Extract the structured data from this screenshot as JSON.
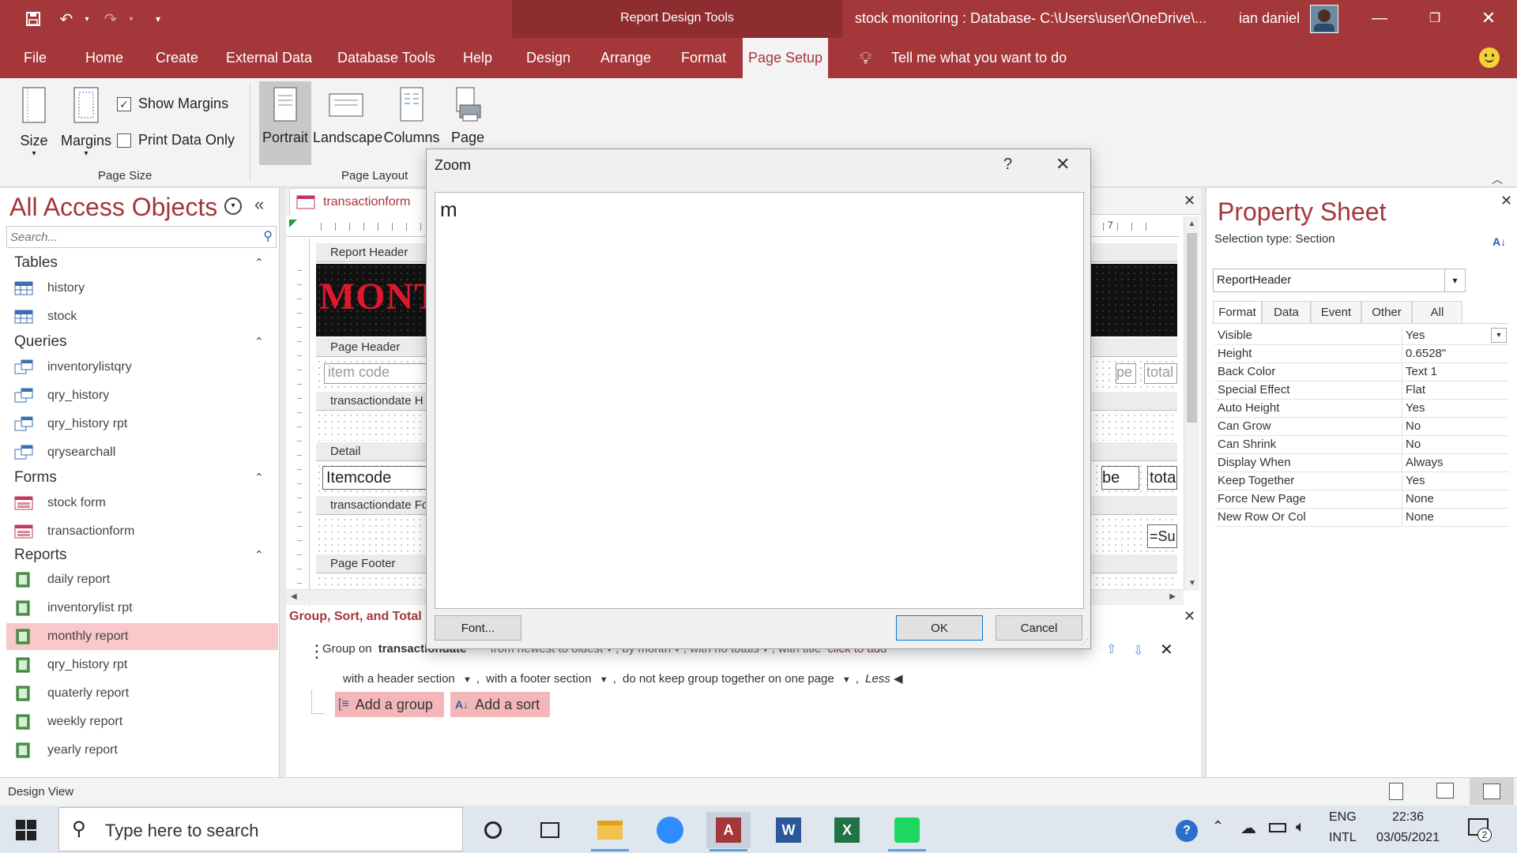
{
  "window": {
    "context_title": "Report Design Tools",
    "title": "stock monitoring : Database- C:\\Users\\user\\OneDrive\\...",
    "user": "ian daniel",
    "colors": {
      "accent": "#a4373a",
      "ribbon": "#f3f3f3",
      "selected": "#f8c8ca"
    }
  },
  "tabs": [
    "File",
    "Home",
    "Create",
    "External Data",
    "Database Tools",
    "Help",
    "Design",
    "Arrange",
    "Format",
    "Page Setup"
  ],
  "active_tab": "Page Setup",
  "tell_me": "Tell me what you want to do",
  "ribbon": {
    "size": "Size",
    "margins": "Margins",
    "show_margins": "Show Margins",
    "print_data_only": "Print Data Only",
    "page_size_group": "Page Size",
    "portrait": "Portrait",
    "landscape": "Landscape",
    "columns": "Columns",
    "page": "Page",
    "page_layout_group": "Page Layout",
    "show_margins_checked": true,
    "print_data_only_checked": false
  },
  "nav": {
    "title": "All Access Objects",
    "search_placeholder": "Search...",
    "categories": [
      {
        "name": "Tables",
        "items": [
          "history",
          "stock"
        ]
      },
      {
        "name": "Queries",
        "items": [
          "inventorylistqry",
          "qry_history",
          "qry_history rpt",
          "qrysearchall"
        ]
      },
      {
        "name": "Forms",
        "items": [
          "stock form",
          "transactionform"
        ]
      },
      {
        "name": "Reports",
        "items": [
          "daily report",
          "inventorylist rpt",
          "monthly report",
          "qry_history rpt",
          "quaterly report",
          "weekly report",
          "yearly report"
        ]
      }
    ],
    "selected_item": "monthly report"
  },
  "document": {
    "tab_label": "transactionform",
    "sections": [
      "Report Header",
      "Page Header",
      "transactiondate H",
      "Detail",
      "transactiondate Fo",
      "Page Footer"
    ],
    "header_text": "MONTI",
    "field_item_code": "item code",
    "field_itemcode": "Itemcode",
    "right_labels": {
      "pe": "pe",
      "total": "total",
      "be": "be",
      "tota": "tota",
      "su": "=Su"
    }
  },
  "group_sort": {
    "title": "Group, Sort, and Total",
    "group_on_label": "Group on",
    "group_on_field": "transactiondate",
    "row1_rest": "from newest to oldest  ▾ , by month  ▾ , with no totals  ▾ , with title",
    "click_to_add": "click to add",
    "with_header": "with a header section",
    "with_footer": "with a footer section",
    "keep_together": "do not keep group together on one page",
    "less": "Less ◀",
    "add_group": "Add a group",
    "add_sort": "Add a sort"
  },
  "zoom_dialog": {
    "title": "Zoom",
    "help": "?",
    "content": "m",
    "font_button": "Font...",
    "ok_button": "OK",
    "cancel_button": "Cancel"
  },
  "property_sheet": {
    "title": "Property Sheet",
    "selection_type": "Selection type:  Section",
    "selected_object": "ReportHeader",
    "tabs": [
      "Format",
      "Data",
      "Event",
      "Other",
      "All"
    ],
    "active_tab": "Format",
    "rows": [
      {
        "name": "Visible",
        "value": "Yes"
      },
      {
        "name": "Height",
        "value": "0.6528\""
      },
      {
        "name": "Back Color",
        "value": "Text 1"
      },
      {
        "name": "Special Effect",
        "value": "Flat"
      },
      {
        "name": "Auto Height",
        "value": "Yes"
      },
      {
        "name": "Can Grow",
        "value": "No"
      },
      {
        "name": "Can Shrink",
        "value": "No"
      },
      {
        "name": "Display When",
        "value": "Always"
      },
      {
        "name": "Keep Together",
        "value": "Yes"
      },
      {
        "name": "Force New Page",
        "value": "None"
      },
      {
        "name": "New Row Or Col",
        "value": "None"
      }
    ]
  },
  "status_bar": {
    "view": "Design View"
  },
  "taskbar": {
    "search_placeholder": "Type here to search",
    "lang1": "ENG",
    "lang2": "INTL",
    "time": "22:36",
    "date": "03/05/2021",
    "notifications": "2"
  }
}
